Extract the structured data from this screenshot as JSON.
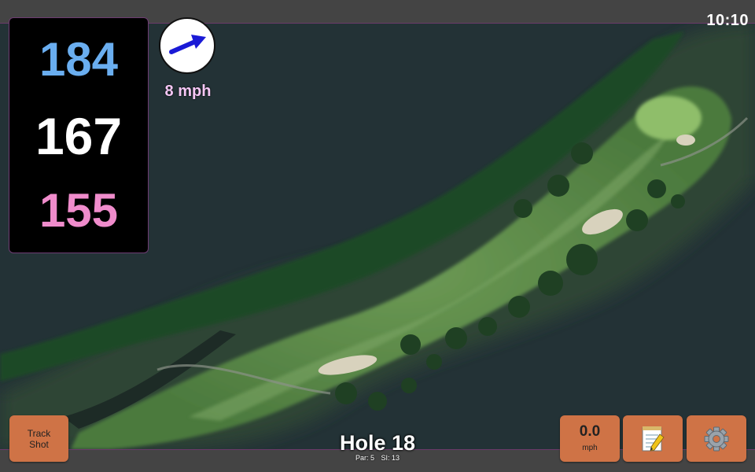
{
  "status_bar": {
    "time": "10:10"
  },
  "distances": {
    "back": "184",
    "middle": "167",
    "front": "155",
    "back_color": "#6aaef0",
    "middle_color": "#ffffff",
    "front_color": "#f08ccc"
  },
  "wind": {
    "speed": "8 mph",
    "icon": "wind-direction-arrow-icon",
    "arrow_color": "#1a1ad6"
  },
  "track_shot": {
    "line1": "Track",
    "line2": "Shot"
  },
  "hole": {
    "title": "Hole 18",
    "par": "Par: 5",
    "stroke_index": "SI: 13"
  },
  "speed_button": {
    "value": "0.0",
    "unit": "mph"
  },
  "notes_button": {
    "icon": "notepad-icon"
  },
  "settings_button": {
    "icon": "gear-icon"
  },
  "colors": {
    "button_orange": "#cf7346",
    "water": "#233236",
    "fairway": "#5e8a4a",
    "trees": "#1f4a26"
  }
}
